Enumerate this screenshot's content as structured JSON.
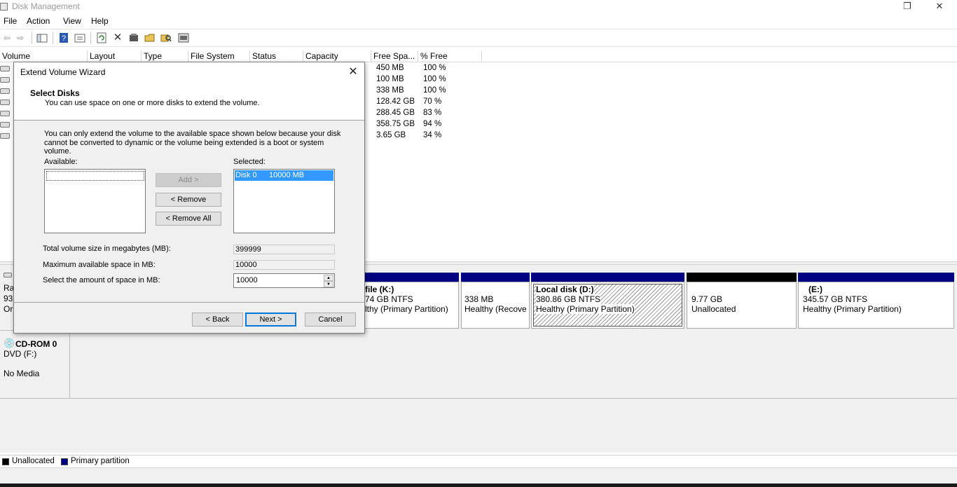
{
  "window": {
    "title": "Disk Management",
    "restore_glyph": "❐",
    "close_glyph": "✕"
  },
  "menu": [
    "File",
    "Action",
    "View",
    "Help"
  ],
  "toolbar": {
    "icons": [
      "back-icon",
      "forward-icon",
      "console-tree-icon",
      "help-icon",
      "properties-icon",
      "refresh-icon",
      "delete-icon",
      "disk-properties-icon",
      "open-icon",
      "explore-icon",
      "settings-icon"
    ]
  },
  "volume_list": {
    "columns": [
      "Volume",
      "Layout",
      "Type",
      "File System",
      "Status",
      "Capacity",
      "Free Spa...",
      "% Free"
    ],
    "rows": [
      {
        "free": "450 MB",
        "pct": "100 %"
      },
      {
        "free": "100 MB",
        "pct": "100 %"
      },
      {
        "free": "338 MB",
        "pct": "100 %"
      },
      {
        "free": "128.42 GB",
        "pct": "70 %"
      },
      {
        "free": "288.45 GB",
        "pct": "83 %"
      },
      {
        "free": "358.75 GB",
        "pct": "94 %"
      },
      {
        "free": "3.65 GB",
        "pct": "34 %"
      }
    ]
  },
  "disk0": {
    "name_partial": "Ra",
    "size_partial": "93",
    "status_partial": "Or",
    "partitions": [
      {
        "name": " file  (K:)",
        "size": "74 GB NTFS",
        "status": "lthy (Primary Partition)",
        "bar_color": "#000080"
      },
      {
        "name": "",
        "size": "338 MB",
        "status": "Healthy (Recove",
        "bar_color": "#000080"
      },
      {
        "name": "Local disk  (D:)",
        "size": "380.86 GB NTFS",
        "status": "Healthy (Primary Partition)",
        "bar_color": "#000080"
      },
      {
        "name": "",
        "size": "9.77 GB",
        "status": "Unallocated",
        "bar_color": "#000000"
      },
      {
        "name": "(E:)",
        "size": "345.57 GB NTFS",
        "status": "Healthy (Primary Partition)",
        "bar_color": "#000080"
      }
    ]
  },
  "cdrom": {
    "name": "CD-ROM 0",
    "drive": "DVD (F:)",
    "media": "No Media"
  },
  "legend": [
    {
      "label": "Unallocated",
      "color": "#000000"
    },
    {
      "label": "Primary partition",
      "color": "#000080"
    }
  ],
  "wizard": {
    "title": "Extend Volume Wizard",
    "heading": "Select Disks",
    "subheading": "You can use space on one or more disks to extend the volume.",
    "info": "You can only extend the volume to the available space shown below because your disk cannot be converted to dynamic or the volume being extended is a boot or system volume.",
    "available_label": "Available:",
    "selected_label": "Selected:",
    "selected_items": [
      {
        "disk": "Disk 0",
        "size": "10000 MB"
      }
    ],
    "add_button": "Add >",
    "remove_button": "< Remove",
    "remove_all_button": "< Remove All",
    "total_label": "Total volume size in megabytes (MB):",
    "total_value": "399999",
    "max_label": "Maximum available space in MB:",
    "max_value": "10000",
    "amount_label": "Select the amount of space in MB:",
    "amount_value": "10000",
    "back_button": "< Back",
    "next_button": "Next >",
    "cancel_button": "Cancel"
  }
}
